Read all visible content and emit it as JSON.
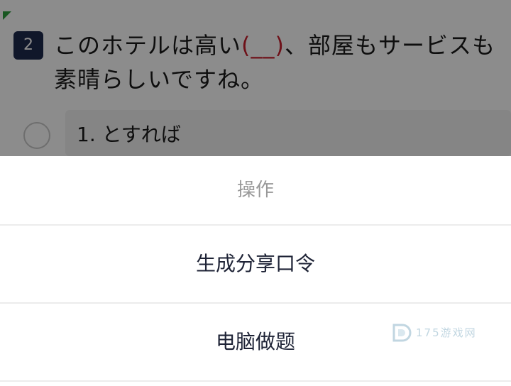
{
  "question": {
    "number": "2",
    "text_before_blank": "このホテルは高い",
    "blank": "(__)",
    "text_after_blank": "、部屋もサービスも素晴らしいですね。",
    "options": [
      {
        "label": "1. とすれば"
      }
    ]
  },
  "action_sheet": {
    "title": "操作",
    "items": [
      {
        "label": "生成分享口令"
      },
      {
        "label": "电脑做题"
      }
    ]
  },
  "watermark": {
    "text": "175游戏网"
  },
  "colors": {
    "badge": "#1e2a4e",
    "blank": "#c8202e",
    "corner_mark": "#2e9e3e",
    "sheet_title": "#999999",
    "sheet_item": "#1e2336"
  }
}
